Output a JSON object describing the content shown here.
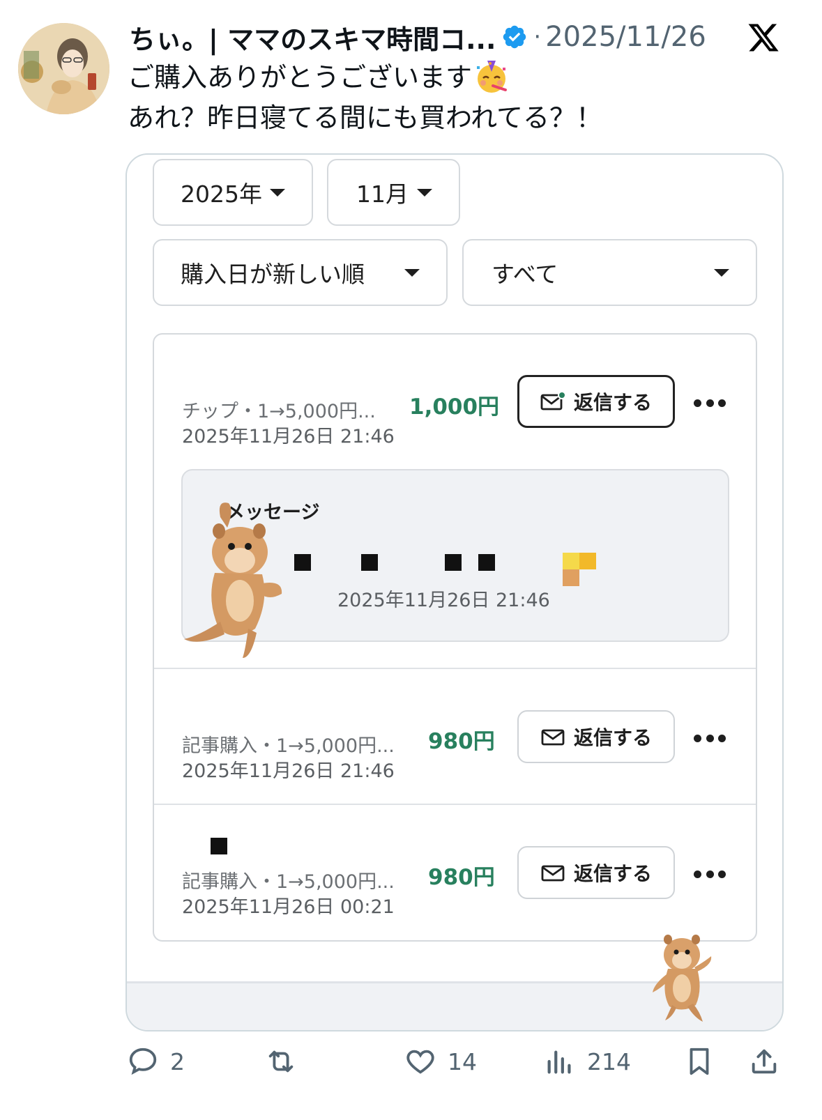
{
  "author": {
    "display_name": "ちぃ。| ママのスキマ時間コ...",
    "verified": true,
    "separator": "·",
    "date": "2025/11/26"
  },
  "post": {
    "line1": "ご購入ありがとうございます",
    "line1_emoji": "partying-face",
    "line2": "あれ？昨日寝てる間にも買われてる？！"
  },
  "screenshot": {
    "filters": {
      "year": "2025年",
      "month": "11月",
      "sort": "購入日が新しい順",
      "type": "すべて"
    },
    "items": [
      {
        "desc": "チップ・1→5,000円...",
        "date": "2025年11月26日 21:46",
        "amount": "1,000円",
        "reply_label": "返信する",
        "reply_icon": "mail-unread-icon",
        "message": {
          "title": "メッセージ",
          "time": "2025年11月26日 21:46"
        }
      },
      {
        "desc": "記事購入・1→5,000円...",
        "date": "2025年11月26日 21:46",
        "amount": "980円",
        "reply_label": "返信する",
        "reply_icon": "mail-icon"
      },
      {
        "desc": "記事購入・1→5,000円...",
        "date": "2025年11月26日 00:21",
        "amount": "980円",
        "reply_label": "返信する",
        "reply_icon": "mail-icon"
      }
    ],
    "colors": {
      "amount": "#28805e",
      "border": "#d5d9dd"
    }
  },
  "actions": {
    "replies": "2",
    "retweets": "",
    "likes": "14",
    "views": "214"
  },
  "colors": {
    "verified": "#1d9bf0",
    "muted": "#536471"
  }
}
